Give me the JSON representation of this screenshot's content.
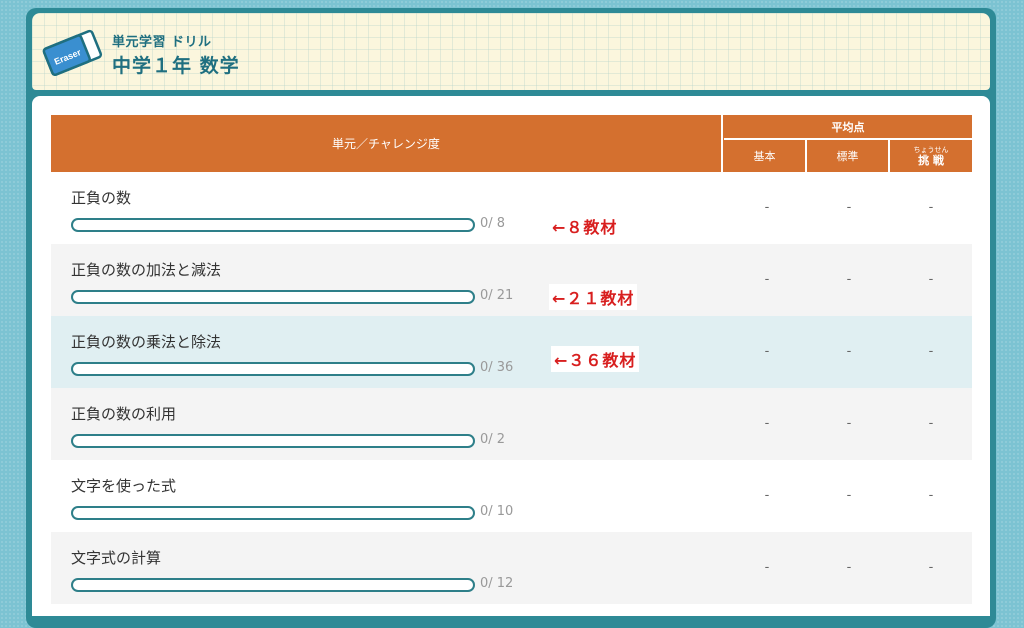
{
  "header": {
    "subtitle": "単元学習 ドリル",
    "title": "中学１年 数学",
    "logo_text": "Eraser"
  },
  "table": {
    "col_unit": "単元／チャレンジ度",
    "col_avg": "平均点",
    "col_basic": "基本",
    "col_standard": "標準",
    "col_challenge_ruby": "ちょうせん",
    "col_challenge": "挑 戦"
  },
  "rows": [
    {
      "name": "正負の数",
      "count": "0/ 8",
      "progress": 0,
      "basic": "-",
      "standard": "-",
      "challenge": "-"
    },
    {
      "name": "正負の数の加法と減法",
      "count": "0/ 21",
      "progress": 0,
      "basic": "-",
      "standard": "-",
      "challenge": "-"
    },
    {
      "name": "正負の数の乗法と除法",
      "count": "0/ 36",
      "progress": 0,
      "basic": "-",
      "standard": "-",
      "challenge": "-"
    },
    {
      "name": "正負の数の利用",
      "count": "0/ 2",
      "progress": 0,
      "basic": "-",
      "standard": "-",
      "challenge": "-"
    },
    {
      "name": "文字を使った式",
      "count": "0/ 10",
      "progress": 0,
      "basic": "-",
      "standard": "-",
      "challenge": "-"
    },
    {
      "name": "文字式の計算",
      "count": "0/ 12",
      "progress": 0,
      "basic": "-",
      "standard": "-",
      "challenge": "-"
    }
  ],
  "annotations": [
    "←８教材",
    "←２１教材",
    "←３６教材"
  ],
  "colors": {
    "header_orange": "#d4702f",
    "teal": "#2e7f89",
    "annotation_red": "#d81f1f"
  }
}
